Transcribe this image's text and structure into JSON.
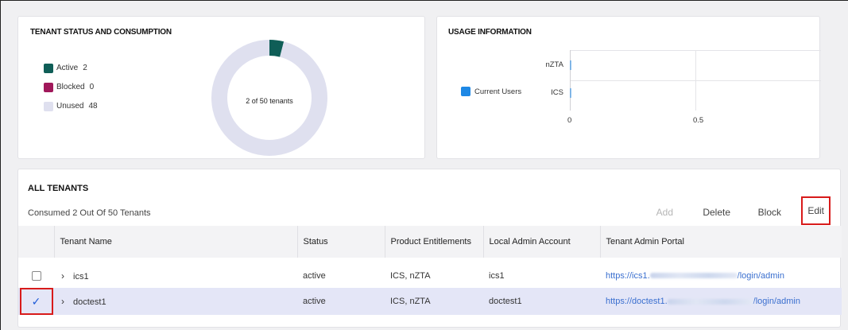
{
  "status_card": {
    "title": "TENANT STATUS AND CONSUMPTION",
    "legend": [
      {
        "label": "Active",
        "count": "2",
        "color": "#0f5e57"
      },
      {
        "label": "Blocked",
        "count": "0",
        "color": "#a0185a"
      },
      {
        "label": "Unused",
        "count": "48",
        "color": "#dfe0ef"
      }
    ],
    "center_text": "2 of 50 tenants"
  },
  "usage_card": {
    "title": "USAGE INFORMATION",
    "legend_label": "Current Users",
    "legend_color": "#1e88e5",
    "x_ticks": [
      "0",
      "0.5"
    ]
  },
  "chart_data": [
    {
      "type": "pie",
      "categories": [
        "Active",
        "Blocked",
        "Unused"
      ],
      "values": [
        2,
        0,
        48
      ],
      "title": "TENANT STATUS AND CONSUMPTION"
    },
    {
      "type": "bar",
      "orientation": "horizontal",
      "categories": [
        "nZTA",
        "ICS"
      ],
      "series": [
        {
          "name": "Current Users",
          "values": [
            0,
            0
          ]
        }
      ],
      "title": "USAGE INFORMATION",
      "xlim": [
        0,
        1
      ]
    }
  ],
  "tenants": {
    "title": "ALL TENANTS",
    "consumed_text": "Consumed 2 Out Of 50 Tenants",
    "actions": {
      "add": "Add",
      "delete": "Delete",
      "block": "Block",
      "edit": "Edit"
    },
    "columns": [
      "Tenant Name",
      "Status",
      "Product Entitlements",
      "Local Admin Account",
      "Tenant Admin Portal"
    ],
    "rows": [
      {
        "name": "ics1",
        "status": "active",
        "entitlements": "ICS, nZTA",
        "admin_account": "ics1",
        "portal_prefix": "https://ics1.",
        "portal_suffix": "/login/admin",
        "selected": false
      },
      {
        "name": "doctest1",
        "status": "active",
        "entitlements": "ICS, nZTA",
        "admin_account": "doctest1",
        "portal_prefix": "https://doctest1.",
        "portal_suffix": "/login/admin",
        "selected": true
      }
    ]
  }
}
